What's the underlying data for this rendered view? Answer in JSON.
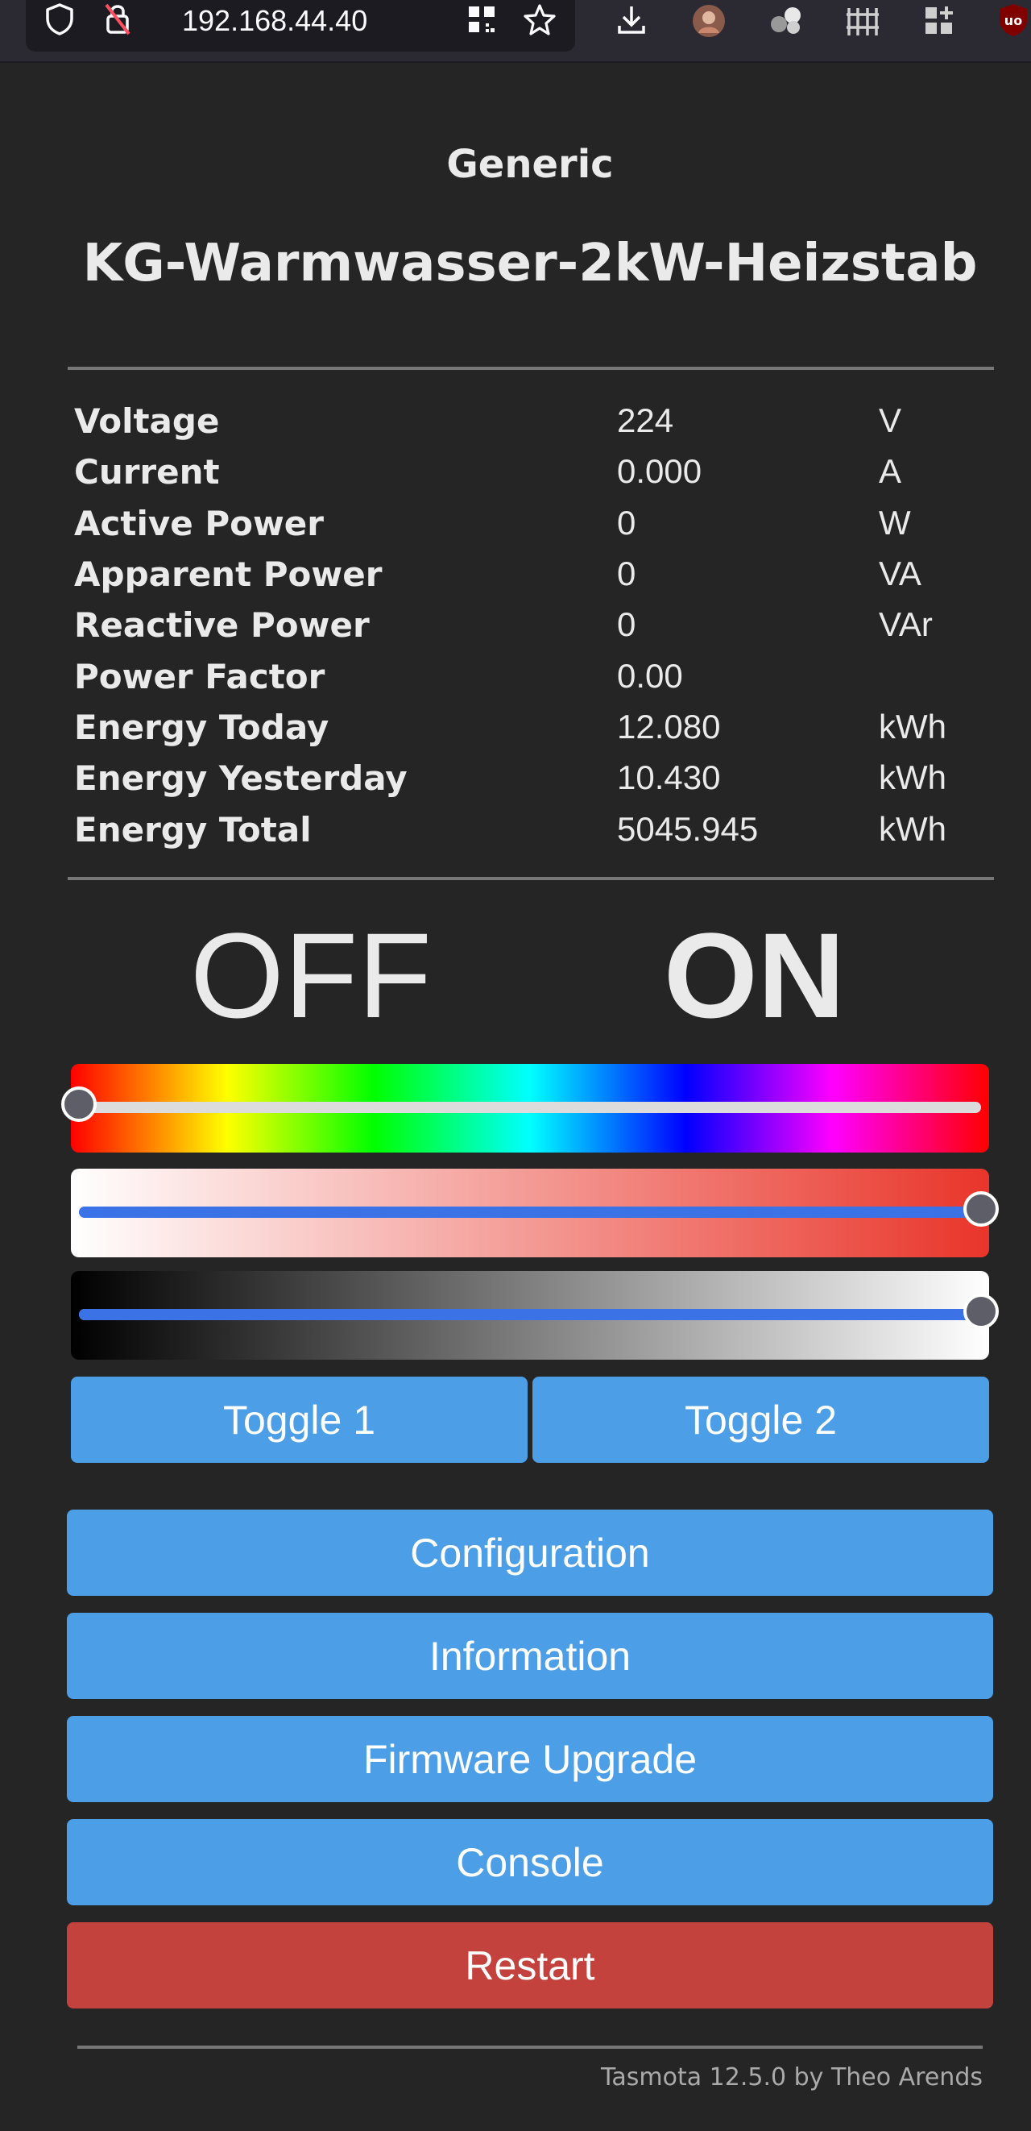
{
  "browser": {
    "url": "192.168.44.40",
    "icons": [
      "shield-icon",
      "insecure-lock-icon",
      "qr-code-icon",
      "bookmark-star-icon",
      "download-icon",
      "profile-avatar-icon",
      "extension-spheres-icon",
      "extension-fence-icon",
      "extensions-grid-icon",
      "ublock-icon"
    ]
  },
  "page": {
    "module": "Generic",
    "device": "KG-Warmwasser-2kW-Heizstab"
  },
  "sensors": [
    {
      "label": "Voltage",
      "value": "224",
      "unit": "V"
    },
    {
      "label": "Current",
      "value": "0.000",
      "unit": "A"
    },
    {
      "label": "Active Power",
      "value": "0",
      "unit": "W"
    },
    {
      "label": "Apparent Power",
      "value": "0",
      "unit": "VA"
    },
    {
      "label": "Reactive Power",
      "value": "0",
      "unit": "VAr"
    },
    {
      "label": "Power Factor",
      "value": "0.00",
      "unit": ""
    },
    {
      "label": "Energy Today",
      "value": "12.080",
      "unit": "kWh"
    },
    {
      "label": "Energy Yesterday",
      "value": "10.430",
      "unit": "kWh"
    },
    {
      "label": "Energy Total",
      "value": "5045.945",
      "unit": "kWh"
    }
  ],
  "power": {
    "off_label": "OFF",
    "on_label": "ON"
  },
  "sliders": {
    "hue_level": 0.0,
    "saturation_level": 1.0,
    "dimmer_level": 1.0,
    "colors": {
      "track": "#d0d0d0",
      "fill": "#3b72e6",
      "thumb": "#5e5e68"
    }
  },
  "toggles": [
    "Toggle 1",
    "Toggle 2"
  ],
  "menu": {
    "configuration": "Configuration",
    "information": "Information",
    "firmware_upgrade": "Firmware Upgrade",
    "console": "Console",
    "restart": "Restart"
  },
  "colors": {
    "background": "#252525",
    "button": "#4c9ee6",
    "restart_button": "#c3423d",
    "text": "#eaeaea"
  },
  "footer": "Tasmota 12.5.0 by Theo Arends"
}
